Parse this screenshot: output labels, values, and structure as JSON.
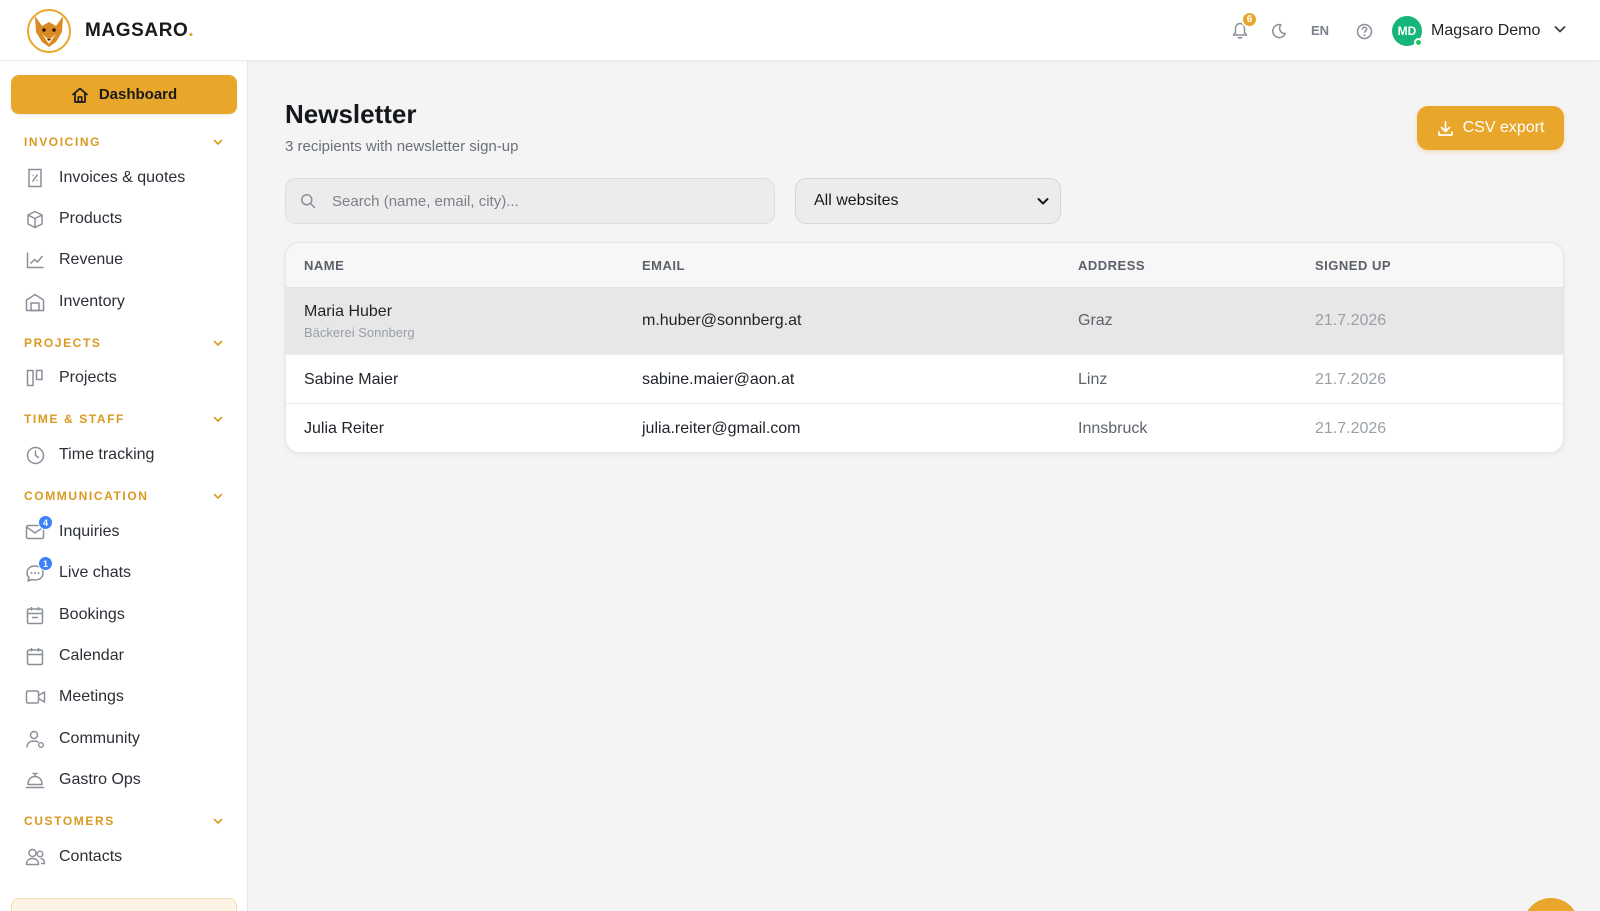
{
  "header": {
    "brand": "MAGSARO",
    "brand_dot": ".",
    "notification_count": "6",
    "language": "EN",
    "user_initials": "MD",
    "user_name": "Magsaro Demo"
  },
  "sidebar": {
    "dashboard_label": "Dashboard",
    "sections": {
      "invoicing": "INVOICING",
      "projects": "PROJECTS",
      "time_staff": "TIME & STAFF",
      "communication": "COMMUNICATION",
      "customers": "CUSTOMERS"
    },
    "items": {
      "invoices": "Invoices & quotes",
      "products": "Products",
      "revenue": "Revenue",
      "inventory": "Inventory",
      "projects": "Projects",
      "time_tracking": "Time tracking",
      "inquiries": "Inquiries",
      "inquiries_badge": "4",
      "live_chats": "Live chats",
      "live_chats_badge": "1",
      "bookings": "Bookings",
      "calendar": "Calendar",
      "meetings": "Meetings",
      "community": "Community",
      "gastro_ops": "Gastro Ops",
      "contacts": "Contacts"
    }
  },
  "main": {
    "title": "Newsletter",
    "subtitle": "3 recipients with newsletter sign-up",
    "csv_button": "CSV export",
    "search_placeholder": "Search (name, email, city)...",
    "website_filter": "All websites",
    "table": {
      "columns": [
        "NAME",
        "EMAIL",
        "ADDRESS",
        "SIGNED UP"
      ],
      "rows": [
        {
          "name": "Maria Huber",
          "company": "Bäckerei Sonnberg",
          "email": "m.huber@sonnberg.at",
          "address": "Graz",
          "signed_up": "21.7.2026"
        },
        {
          "name": "Sabine Maier",
          "company": "",
          "email": "sabine.maier@aon.at",
          "address": "Linz",
          "signed_up": "21.7.2026"
        },
        {
          "name": "Julia Reiter",
          "company": "",
          "email": "julia.reiter@gmail.com",
          "address": "Innsbruck",
          "signed_up": "21.7.2026"
        }
      ]
    }
  },
  "colors": {
    "accent": "#e8a72a",
    "avatar": "#16b67a",
    "badge_blue": "#3b82f6"
  }
}
